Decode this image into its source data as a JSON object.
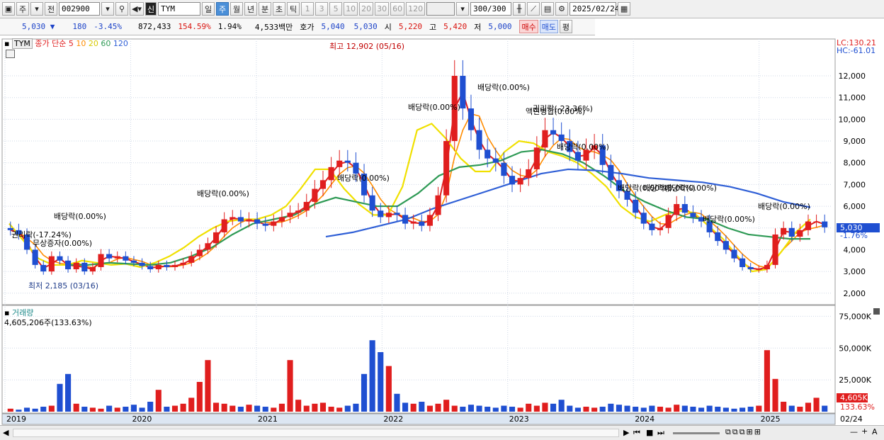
{
  "toolbar": {
    "period_label": "주",
    "prev_label": "전",
    "code": "002900",
    "stock_badge": "신",
    "stock_name": "TYM",
    "tabs": [
      "일",
      "주",
      "월",
      "년",
      "분",
      "초",
      "틱"
    ],
    "selected_tab": "주",
    "ticks": [
      "1",
      "3",
      "5",
      "10",
      "20",
      "30",
      "60",
      "120"
    ],
    "count": "300",
    "count_total": "/300",
    "date": "2025/02/24"
  },
  "quote": {
    "price": "5,030",
    "change": "180",
    "change_pct": "-3.45%",
    "volume": "872,433",
    "vol_ratio": "154.59%",
    "turnover": "1.94%",
    "amount": "4,533백만",
    "ask_label": "호가",
    "ask": "5,040",
    "bid": "5,030",
    "open_label": "시",
    "open": "5,220",
    "high_label": "고",
    "high": "5,420",
    "low_label": "저",
    "low": "5,000",
    "buy_label": "매수",
    "sell_label": "매도",
    "eval_label": "평"
  },
  "legend": {
    "name": "TYM",
    "ma_label": "종가 단순",
    "ma": [
      "5",
      "10",
      "20",
      "60",
      "120"
    ]
  },
  "price_scale": {
    "lc": "LC:130.21",
    "hc": "HC:-61.01",
    "current": "5,030",
    "current_pct": "-1.76%"
  },
  "volume_legend": {
    "label": "거래량",
    "value": "4,605,206주(133.63%)",
    "current": "4,605K",
    "current_pct": "133.63%"
  },
  "colors": {
    "up": "#e01e1e",
    "down": "#1f4fd1",
    "ma5": "#e01e1e",
    "ma10": "#ff8c00",
    "ma20": "#f0e000",
    "ma60": "#2e9a55",
    "ma120": "#2f5fd6",
    "hl": "#cfd8e6"
  },
  "chart_data": {
    "type": "candlestick",
    "x_axis": {
      "labels": [
        "2019",
        "2020",
        "2021",
        "2022",
        "2023",
        "2024",
        "2025",
        "02/24"
      ]
    },
    "price_axis": {
      "range": [
        1700,
        13500
      ],
      "ticks": [
        2000,
        3000,
        4000,
        5000,
        6000,
        7000,
        8000,
        9000,
        10000,
        11000,
        12000
      ],
      "tick_labels": [
        "2,000",
        "3,000",
        "4,000",
        "5,000",
        "6,000",
        "7,000",
        "8,000",
        "9,000",
        "10,000",
        "11,000",
        "12,000"
      ]
    },
    "volume_axis": {
      "range": [
        0,
        78000
      ],
      "ticks": [
        25000,
        50000,
        75000
      ],
      "tick_labels": [
        "25,000K",
        "50,000K",
        "75,000K"
      ]
    },
    "closes": [
      4900,
      4700,
      4000,
      3300,
      3000,
      3700,
      3500,
      3100,
      3400,
      3000,
      3200,
      3800,
      3600,
      3700,
      3500,
      3400,
      3250,
      3100,
      3300,
      3200,
      3300,
      3400,
      3700,
      4000,
      4300,
      4800,
      5400,
      5500,
      5300,
      5400,
      5200,
      5100,
      5300,
      5500,
      5700,
      5800,
      6200,
      6800,
      7200,
      7800,
      8100,
      8000,
      7500,
      6500,
      5800,
      5500,
      5700,
      5600,
      5200,
      5300,
      5100,
      5600,
      6500,
      9000,
      12000,
      10500,
      9500,
      8600,
      8200,
      8000,
      7400,
      7000,
      7300,
      7700,
      8700,
      9500,
      9300,
      9000,
      8500,
      8100,
      8600,
      8800,
      7900,
      7200,
      6700,
      6300,
      5700,
      5200,
      4900,
      5000,
      5600,
      6100,
      5700,
      5500,
      5300,
      4800,
      4400,
      4000,
      3600,
      3200,
      3100,
      3100,
      3300,
      4700,
      5000,
      4600,
      4900,
      5300,
      5300,
      5030
    ],
    "ma20_curve": [
      5200,
      4400,
      3600,
      3300,
      3300,
      3500,
      3400,
      3300,
      3350,
      3200,
      3400,
      3700,
      4100,
      4600,
      5000,
      5300,
      5400,
      5400,
      5600,
      6000,
      6800,
      7700,
      7700,
      6800,
      6100,
      5600,
      5600,
      6900,
      9500,
      9800,
      9100,
      8200,
      7600,
      7600,
      8500,
      9000,
      8900,
      8500,
      8300,
      8000,
      7500,
      6900,
      6000,
      5500,
      5300,
      5600,
      5800,
      5700,
      5100,
      4500,
      3700,
      3000,
      3100,
      3900,
      4800,
      5400
    ],
    "ma60_curve": [
      3300,
      3300,
      3400,
      3350,
      3300,
      3400,
      3700,
      4100,
      4700,
      5200,
      5400,
      5600,
      6100,
      6400,
      6200,
      6000,
      6000,
      6600,
      7400,
      7800,
      7900,
      8100,
      8500,
      8600,
      8400,
      8000,
      7400,
      6700,
      6200,
      5800,
      5500,
      5400,
      5000,
      4700,
      4600,
      4500,
      4500
    ],
    "ma120_curve": [
      4600,
      4800,
      5100,
      5400,
      5900,
      6300,
      6700,
      7100,
      7500,
      7700,
      7650,
      7500,
      7300,
      7200,
      7100,
      6900,
      6600,
      6200,
      5950
    ],
    "volumes_pct": [
      3,
      2,
      4,
      3,
      5,
      6,
      28,
      38,
      8,
      5,
      4,
      3,
      6,
      4,
      5,
      7,
      4,
      10,
      22,
      5,
      6,
      8,
      14,
      30,
      52,
      9,
      8,
      6,
      5,
      7,
      6,
      5,
      4,
      8,
      52,
      12,
      6,
      8,
      9,
      5,
      4,
      6,
      8,
      38,
      72,
      60,
      46,
      18,
      9,
      8,
      10,
      6,
      8,
      12,
      6,
      5,
      7,
      6,
      5,
      4,
      6,
      5,
      4,
      8,
      6,
      9,
      8,
      12,
      6,
      4,
      5,
      4,
      5,
      8,
      7,
      6,
      5,
      4,
      6,
      5,
      4,
      7,
      6,
      5,
      4,
      6,
      5,
      4,
      3,
      4,
      5,
      6,
      62,
      33,
      10,
      6,
      5,
      9,
      14,
      6
    ],
    "annotations": [
      "최고 12,902 (05/16)",
      "최저 2,185 (03/16)",
      "배당락(0.00%)",
      "권리락(-17.24%)",
      "무상증자(0.00%)",
      "배당락(0.00%)",
      "배당락(0.00%)",
      "배당락(0.00%)",
      "배당락(0.00%)",
      "배당락(0.00%)",
      "권리락(-23.36%)",
      "액면병합(0.00%)",
      "배당락(0.00%)",
      "배당락(0.00%)",
      "배당락(0.00%)",
      "배당락(0.00%)",
      "배당락(0.00%)"
    ]
  }
}
